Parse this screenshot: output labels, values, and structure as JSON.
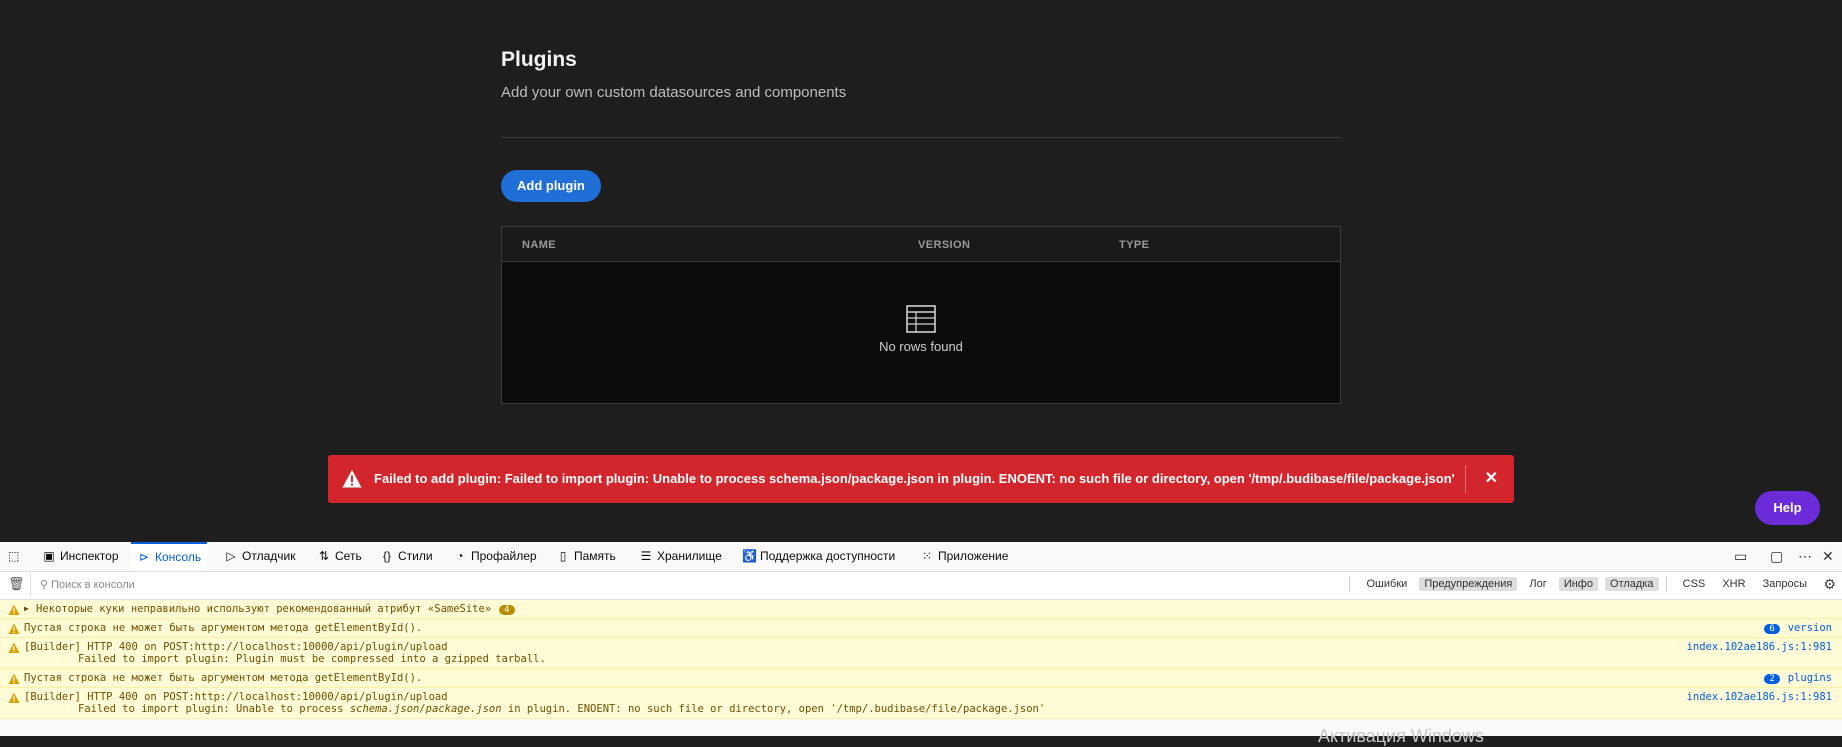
{
  "page": {
    "title": "Plugins",
    "subtitle": "Add your own custom datasources and components",
    "add_button": "Add plugin"
  },
  "table": {
    "columns": [
      "NAME",
      "VERSION",
      "TYPE"
    ],
    "empty_text": "No rows found"
  },
  "toast": {
    "message": "Failed to add plugin: Failed to import plugin: Unable to process schema.json/package.json in plugin. ENOENT: no such file or directory, open '/tmp/.budibase/file/package.json'"
  },
  "help_label": "Help",
  "devtools": {
    "tabs": [
      {
        "label": "Инспектор",
        "icon": "inspector-icon"
      },
      {
        "label": "Консоль",
        "icon": "console-icon"
      },
      {
        "label": "Отладчик",
        "icon": "debugger-icon"
      },
      {
        "label": "Сеть",
        "icon": "network-icon"
      },
      {
        "label": "Стили",
        "icon": "styles-icon"
      },
      {
        "label": "Профайлер",
        "icon": "profiler-icon"
      },
      {
        "label": "Память",
        "icon": "memory-icon"
      },
      {
        "label": "Хранилище",
        "icon": "storage-icon"
      },
      {
        "label": "Поддержка доступности",
        "icon": "accessibility-icon"
      },
      {
        "label": "Приложение",
        "icon": "application-icon"
      }
    ],
    "filter_placeholder": "Поиск в консоли",
    "filters": {
      "errors": "Ошибки",
      "warnings": "Предупреждения",
      "log": "Лог",
      "info": "Инфо",
      "debug": "Отладка",
      "css": "CSS",
      "xhr": "XHR",
      "requests": "Запросы"
    },
    "messages": [
      {
        "text": "Некоторые куки неправильно используют рекомендованный атрибут «SameSite»",
        "count": "4"
      },
      {
        "text": "Пустая строка не может быть аргументом метода getElementById().",
        "count": "6",
        "source": "version"
      },
      {
        "text": "[Builder] HTTP 400 on POST:http://localhost:10000/api/plugin/upload",
        "detail": "Failed to import plugin: Plugin must be compressed into a gzipped tarball.",
        "source": "index.102ae186.js:1:981"
      },
      {
        "text": "Пустая строка не может быть аргументом метода getElementById().",
        "count": "2",
        "source": "plugins"
      },
      {
        "text": "[Builder] HTTP 400 on POST:http://localhost:10000/api/plugin/upload",
        "detail_a": "Failed to import plugin: Unable to process ",
        "detail_b": "schema.json/package.json",
        "detail_c": " in plugin. ENOENT: no such file or directory, open '/tmp/.budibase/file/package.json'",
        "source": "index.102ae186.js:1:981"
      }
    ]
  },
  "watermark": "Активация Windows"
}
